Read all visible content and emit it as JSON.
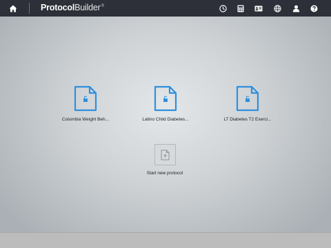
{
  "header": {
    "brand_bold": "Protocol",
    "brand_light": "Builder",
    "brand_mark": "®",
    "icons": [
      "home-icon",
      "clock-icon",
      "calculator-icon",
      "id-card-icon",
      "globe-icon",
      "user-icon",
      "help-icon"
    ]
  },
  "protocols": [
    {
      "label": "Columbia Weight Beh..."
    },
    {
      "label": "Latino Child Diabetes..."
    },
    {
      "label": "LT Diabetes T2 Exerci..."
    }
  ],
  "new_protocol": {
    "label": "Start new protocol"
  },
  "colors": {
    "topbar": "#2d3038",
    "accent": "#2f8fde",
    "footer": "#bcbcbc"
  }
}
